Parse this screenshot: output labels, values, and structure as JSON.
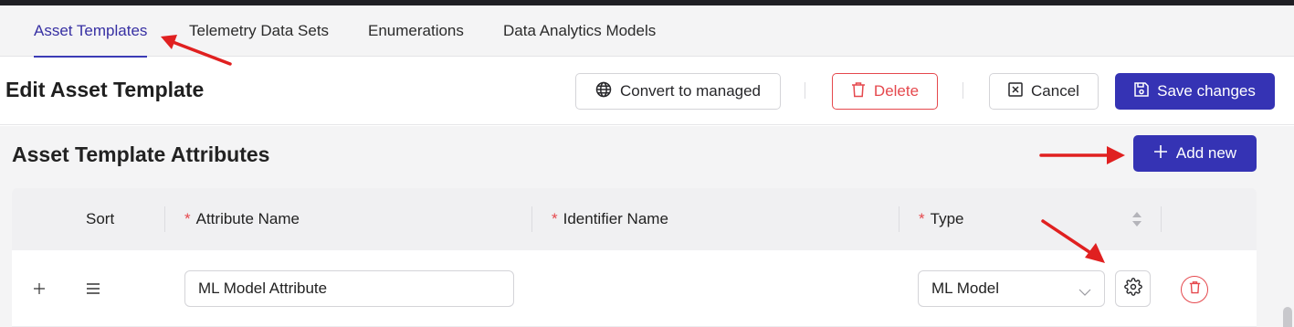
{
  "tabs": [
    {
      "label": "Asset Templates",
      "active": true
    },
    {
      "label": "Telemetry Data Sets",
      "active": false
    },
    {
      "label": "Enumerations",
      "active": false
    },
    {
      "label": "Data Analytics Models",
      "active": false
    }
  ],
  "header": {
    "title": "Edit Asset Template",
    "convert_label": "Convert to managed",
    "delete_label": "Delete",
    "cancel_label": "Cancel",
    "save_label": "Save changes"
  },
  "attributes": {
    "title": "Asset Template Attributes",
    "add_label": "Add new",
    "columns": {
      "sort": "Sort",
      "attribute_name": "Attribute Name",
      "identifier_name": "Identifier Name",
      "type": "Type",
      "required_mark": "*"
    },
    "rows": [
      {
        "attribute_name": "ML Model Attribute",
        "identifier_name": "",
        "type": "ML Model"
      }
    ]
  },
  "colors": {
    "accent": "#3533b4",
    "danger": "#e5484d",
    "annotation_arrow": "#e02020"
  }
}
